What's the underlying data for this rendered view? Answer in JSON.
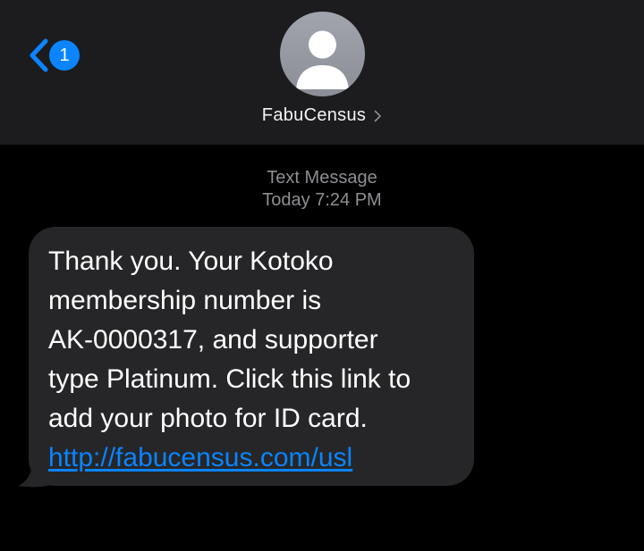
{
  "header": {
    "back_badge_count": "1",
    "contact_name": "FabuCensus"
  },
  "thread": {
    "service_label": "Text Message",
    "timestamp": "Today 7:24 PM"
  },
  "message": {
    "lines": [
      "Thank you. Your Kotoko",
      "membership number is",
      "AK-0000317, and supporter",
      "type Platinum. Click this link to",
      "add your photo for ID card."
    ],
    "link_text": "http://fabucensus.com/usl"
  },
  "colors": {
    "accent": "#0a84ff",
    "header_bg": "#1c1c1e",
    "bubble_bg": "#262628",
    "background": "#000000"
  },
  "icons": {
    "back": "chevron-left-icon",
    "avatar": "person-silhouette-icon",
    "contact_detail": "chevron-right-icon"
  }
}
